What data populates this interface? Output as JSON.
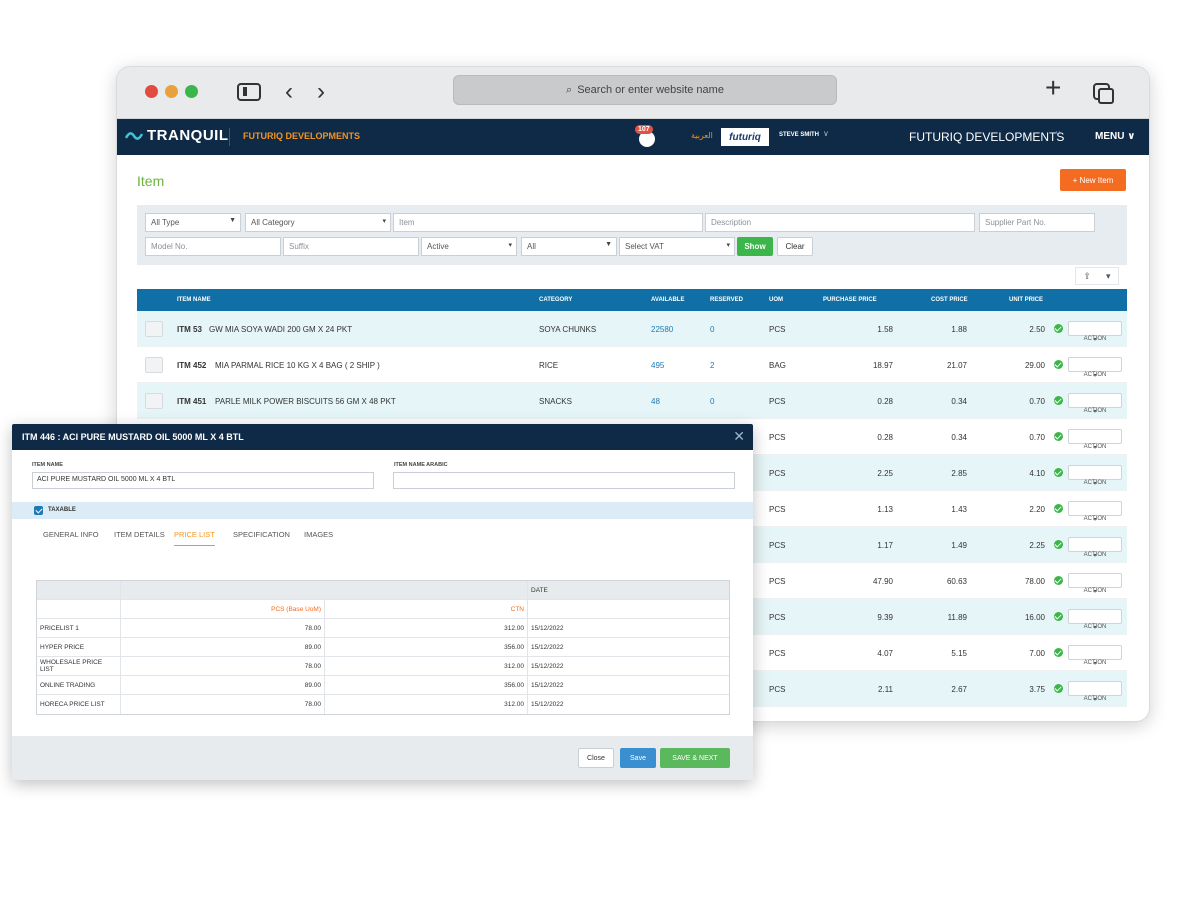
{
  "browser": {
    "url_placeholder": "Search or enter website name"
  },
  "appbar": {
    "brand": "TRANQUIL",
    "company_left": "FUTURIQ DEVELOPMENTS",
    "notification_count": "107",
    "language": "العربية",
    "partner_logo": "futuriq",
    "user": "STEVE SMITH",
    "company_right": "FUTURIQ DEVELOPMENTS",
    "menu": "MENU"
  },
  "page": {
    "title": "Item",
    "new_item": "+ New Item"
  },
  "filters": {
    "type": "All Type",
    "category": "All Category",
    "item_placeholder": "Item",
    "description_placeholder": "Description",
    "supplier_placeholder": "Supplier Part No.",
    "model_placeholder": "Model No.",
    "suffix_placeholder": "Suffix",
    "status": "Active",
    "all": "All",
    "vat": "Select VAT",
    "show": "Show",
    "clear": "Clear"
  },
  "grid": {
    "columns": [
      "ITEM NAME",
      "CATEGORY",
      "AVAILABLE",
      "RESERVED",
      "UOM",
      "PURCHASE PRICE",
      "COST PRICE",
      "UNIT PRICE"
    ],
    "action_label": "ACTION",
    "rows": [
      {
        "code": "ITM 53",
        "name": "GW MIA SOYA WADI 200 GM X 24 PKT",
        "category": "SOYA CHUNKS",
        "available": "22580",
        "reserved": "0",
        "uom": "PCS",
        "purchase": "1.58",
        "cost": "1.88",
        "unit": "2.50"
      },
      {
        "code": "ITM 452",
        "name": "MIA PARMAL RICE 10 KG X 4 BAG ( 2 SHIP )",
        "category": "RICE",
        "available": "495",
        "reserved": "2",
        "uom": "BAG",
        "purchase": "18.97",
        "cost": "21.07",
        "unit": "29.00"
      },
      {
        "code": "ITM 451",
        "name": "PARLE MILK POWER BISCUITS 56 GM X 48 PKT",
        "category": "SNACKS",
        "available": "48",
        "reserved": "0",
        "uom": "PCS",
        "purchase": "0.28",
        "cost": "0.34",
        "unit": "0.70"
      },
      {
        "uom": "PCS",
        "purchase": "0.28",
        "cost": "0.34",
        "unit": "0.70"
      },
      {
        "uom": "PCS",
        "purchase": "2.25",
        "cost": "2.85",
        "unit": "4.10"
      },
      {
        "uom": "PCS",
        "purchase": "1.13",
        "cost": "1.43",
        "unit": "2.20"
      },
      {
        "uom": "PCS",
        "purchase": "1.17",
        "cost": "1.49",
        "unit": "2.25"
      },
      {
        "uom": "PCS",
        "purchase": "47.90",
        "cost": "60.63",
        "unit": "78.00"
      },
      {
        "uom": "PCS",
        "purchase": "9.39",
        "cost": "11.89",
        "unit": "16.00"
      },
      {
        "uom": "PCS",
        "purchase": "4.07",
        "cost": "5.15",
        "unit": "7.00"
      },
      {
        "uom": "PCS",
        "purchase": "2.11",
        "cost": "2.67",
        "unit": "3.75"
      }
    ]
  },
  "modal": {
    "title": "ITM 446 : ACI PURE MUSTARD OIL 5000 ML X 4 BTL",
    "item_name_label": "ITEM NAME",
    "item_name_value": "ACI PURE MUSTARD OIL 5000 ML X 4 BTL",
    "item_name_arabic_label": "ITEM NAME ARABIC",
    "item_name_arabic_value": "",
    "taxable": "TAXABLE",
    "tabs": [
      "GENERAL INFO",
      "ITEM DETAILS",
      "PRICE LIST",
      "SPECIFICATION",
      "IMAGES"
    ],
    "price_table": {
      "date_header": "DATE",
      "pcs_header": "PCS (Base UoM)",
      "ctn_header": "CTN",
      "rows": [
        {
          "name": "PRICELIST 1",
          "pcs": "78.00",
          "ctn": "312.00",
          "date": "15/12/2022"
        },
        {
          "name": "HYPER PRICE",
          "pcs": "89.00",
          "ctn": "356.00",
          "date": "15/12/2022"
        },
        {
          "name": "WHOLESALE PRICE LIST",
          "pcs": "78.00",
          "ctn": "312.00",
          "date": "15/12/2022"
        },
        {
          "name": "ONLINE TRADING",
          "pcs": "89.00",
          "ctn": "356.00",
          "date": "15/12/2022"
        },
        {
          "name": "HORECA PRICE LIST",
          "pcs": "78.00",
          "ctn": "312.00",
          "date": "15/12/2022"
        }
      ]
    },
    "close": "Close",
    "save": "Save",
    "save_next": "SAVE & NEXT"
  }
}
